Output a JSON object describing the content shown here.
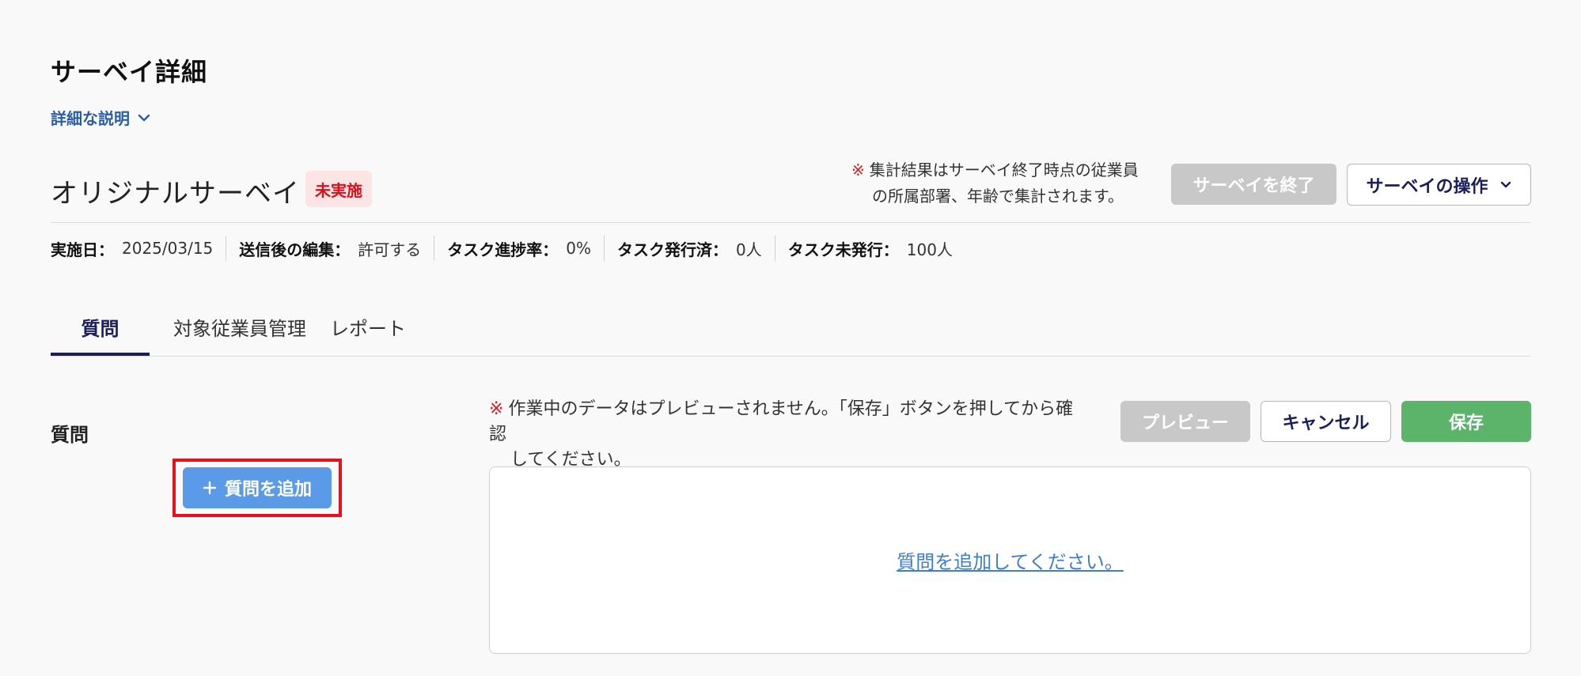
{
  "header": {
    "title": "サーベイ詳細",
    "description_toggle": "詳細な説明"
  },
  "survey": {
    "name": "オリジナルサーベイ",
    "status": "未実施",
    "notice_mark": "※",
    "notice_line1": "集計結果はサーベイ終了時点の従業員",
    "notice_line2": "の所属部署、年齢で集計されます。",
    "end_button": "サーベイを終了",
    "ops_button": "サーベイの操作"
  },
  "meta": [
    {
      "label": "実施日：",
      "value": "2025/03/15"
    },
    {
      "label": "送信後の編集：",
      "value": "許可する"
    },
    {
      "label": "タスク進捗率：",
      "value": "0%"
    },
    {
      "label": "タスク発行済：",
      "value": "0人"
    },
    {
      "label": "タスク未発行：",
      "value": "100人"
    }
  ],
  "tabs": [
    {
      "label": "質問",
      "active": true
    },
    {
      "label": "対象従業員管理",
      "active": false
    },
    {
      "label": "レポート",
      "active": false
    }
  ],
  "questions": {
    "section_title": "質問",
    "add_button": "質問を追加",
    "notice_mark": "※",
    "notice_line1": "作業中のデータはプレビューされません。「保存」ボタンを押してから確認",
    "notice_line2": "してください。",
    "preview_button": "プレビュー",
    "cancel_button": "キャンセル",
    "save_button": "保存",
    "empty_link": "質問を追加してください。"
  },
  "colors": {
    "accent_navy": "#1a1f5c",
    "link_blue": "#2a5da8",
    "add_button_blue": "#5a9ae6",
    "save_green": "#5cb46a",
    "status_red": "#d8101c",
    "disabled_gray": "#c8c8c8",
    "highlight_red": "#e8101c"
  }
}
